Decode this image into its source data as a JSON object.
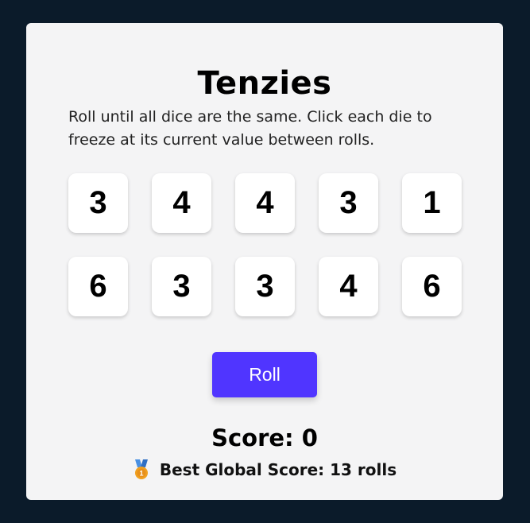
{
  "title": "Tenzies",
  "instructions": "Roll until all dice are the same. Click each die to freeze at its current value between rolls.",
  "dice": [
    {
      "value": "3"
    },
    {
      "value": "4"
    },
    {
      "value": "4"
    },
    {
      "value": "3"
    },
    {
      "value": "1"
    },
    {
      "value": "6"
    },
    {
      "value": "3"
    },
    {
      "value": "3"
    },
    {
      "value": "4"
    },
    {
      "value": "6"
    }
  ],
  "roll_button": {
    "label": "Roll"
  },
  "score": {
    "text": "Score: 0"
  },
  "best": {
    "text": "Best Global Score: 13 rolls",
    "icon": "medal-icon"
  },
  "colors": {
    "background": "#0b1b2a",
    "card": "#f4f4f5",
    "die": "#ffffff",
    "accent": "#5035ff",
    "medal_ribbon": "#4a90e2",
    "medal_gold": "#f0a020"
  }
}
